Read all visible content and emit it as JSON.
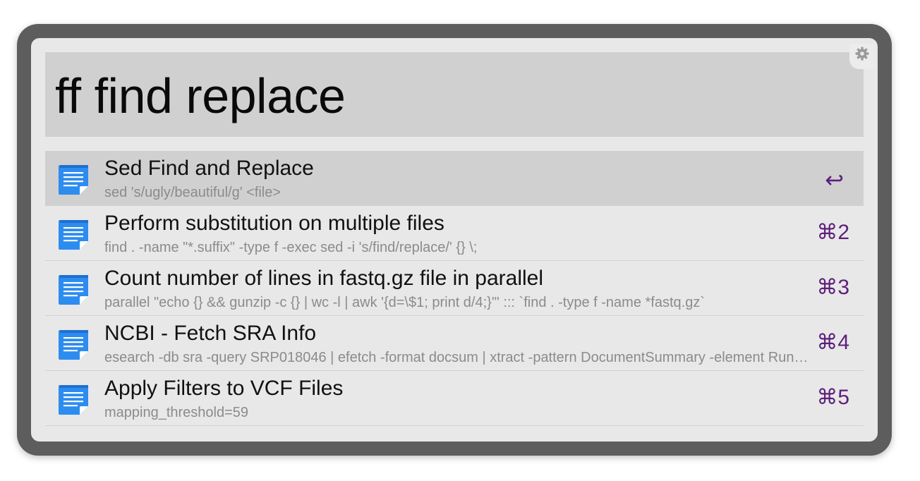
{
  "search": {
    "query": "ff find replace"
  },
  "icons": {
    "settings": "gear-icon",
    "result": "snippet-document-icon",
    "enter": "return-key-icon"
  },
  "colors": {
    "accent": "#5d1f7c",
    "doc_icon": "#2d8cf0",
    "selected_row": "#d0d0d0"
  },
  "results": [
    {
      "title": "Sed Find and Replace",
      "subtitle": "sed 's/ugly/beautiful/g' <file>",
      "shortcut": "↩",
      "selected": true
    },
    {
      "title": "Perform substitution on multiple files",
      "subtitle": "find . -name \"*.suffix\" -type f -exec sed -i 's/find/replace/' {} \\;",
      "shortcut": "⌘2"
    },
    {
      "title": "Count number of lines in fastq.gz file in parallel",
      "subtitle": "parallel \"echo {} && gunzip -c {} | wc -l | awk '{d=\\$1; print d/4;}'\" ::: `find . -type f -name *fastq.gz`",
      "shortcut": "⌘3"
    },
    {
      "title": "NCBI - Fetch SRA Info",
      "subtitle": "esearch -db sra -query SRP018046 | efetch -format docsum | xtract -pattern DocumentSummary -element Run@acc",
      "shortcut": "⌘4"
    },
    {
      "title": "Apply Filters to VCF Files",
      "subtitle": "mapping_threshold=59",
      "shortcut": "⌘5"
    }
  ]
}
